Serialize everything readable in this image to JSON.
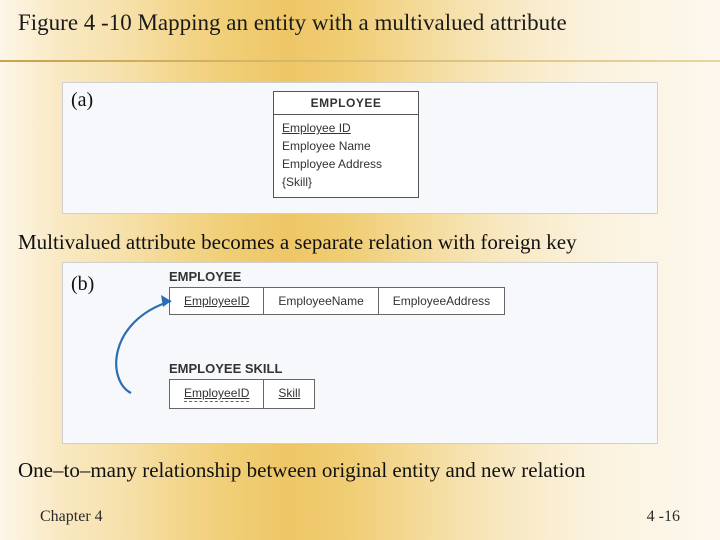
{
  "title": "Figure 4 -10 Mapping an entity with a multivalued attribute",
  "panel_a": {
    "label": "(a)",
    "entity": {
      "name": "EMPLOYEE",
      "attrs": {
        "pk": "Employee ID",
        "a2": "Employee Name",
        "a3": "Employee Address",
        "mv": "{Skill}"
      }
    }
  },
  "caption_mid": "Multivalued attribute becomes a separate relation with foreign key",
  "panel_b": {
    "label": "(b)",
    "rel1": {
      "name": "EMPLOYEE",
      "cols": {
        "c1": "EmployeeID",
        "c2": "EmployeeName",
        "c3": "EmployeeAddress"
      }
    },
    "rel2": {
      "name": "EMPLOYEE SKILL",
      "cols": {
        "c1": "EmployeeID",
        "c2": "Skill"
      }
    }
  },
  "caption_bot": "One–to–many relationship between original entity and new relation",
  "footer": {
    "left": "Chapter 4",
    "right": "4 -16"
  }
}
